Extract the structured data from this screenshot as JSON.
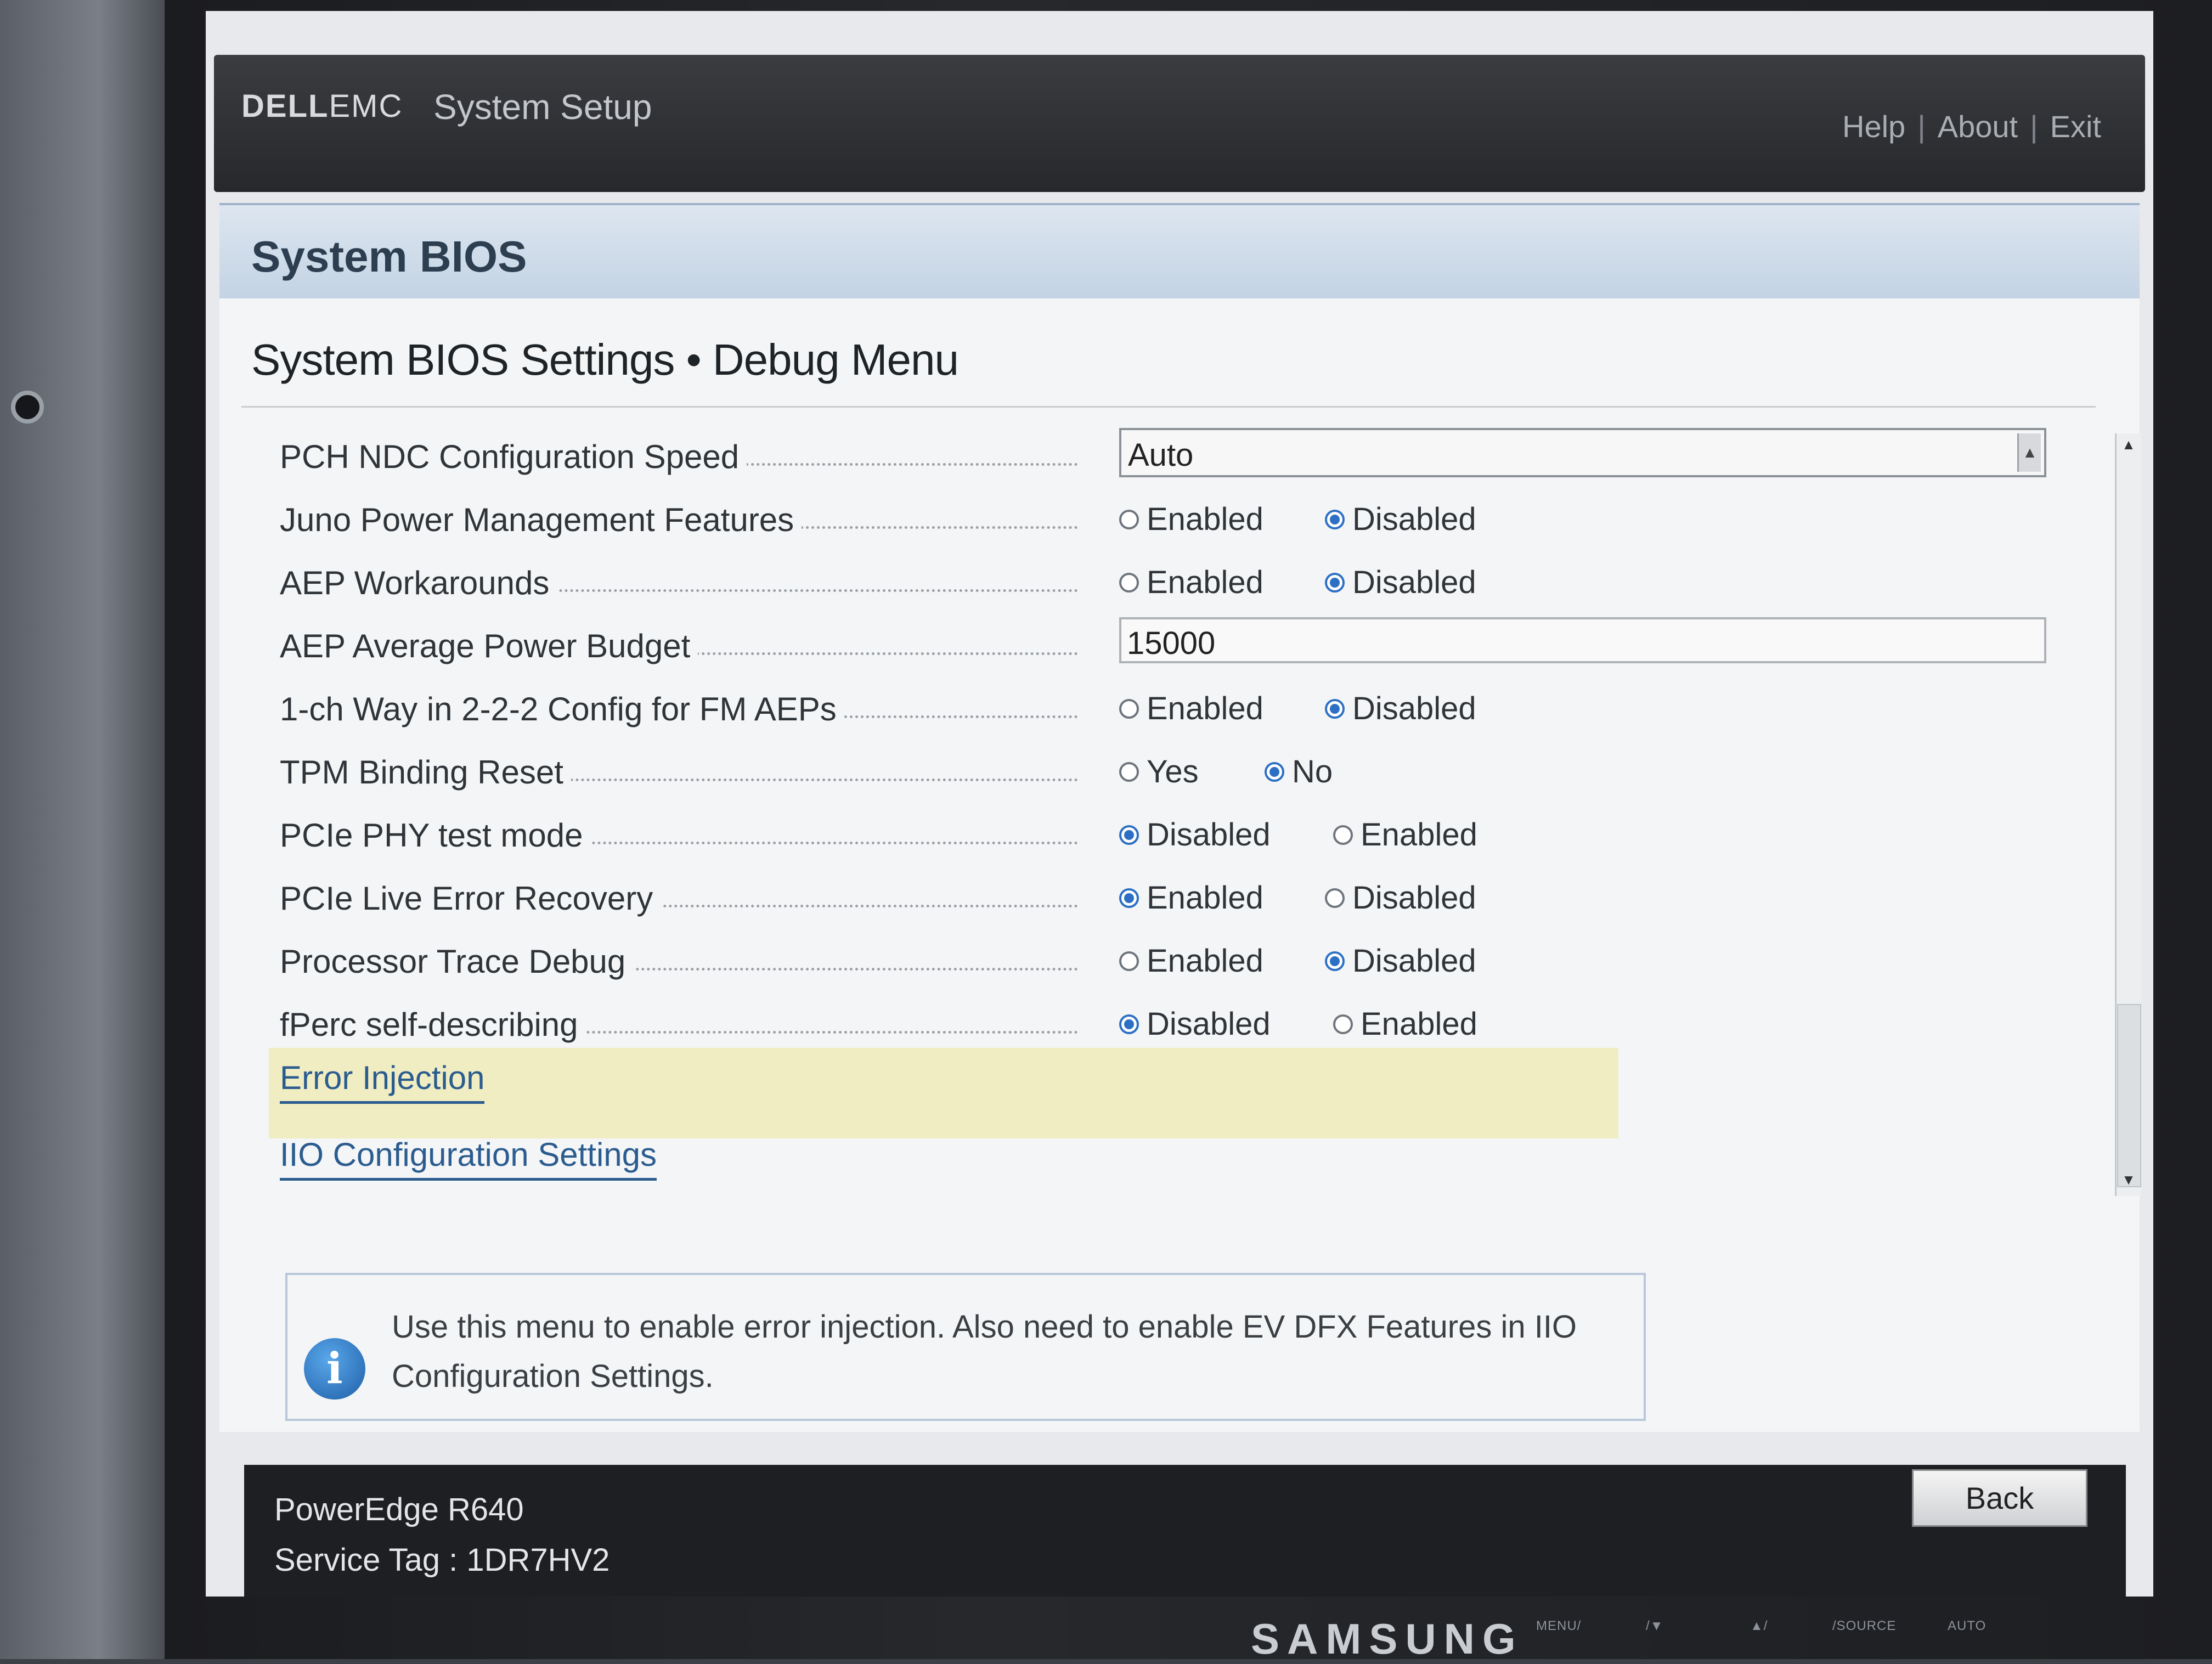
{
  "header": {
    "logo_bold": "DELL",
    "logo_light": "EMC",
    "app_title": "System Setup",
    "links": [
      "Help",
      "About",
      "Exit"
    ]
  },
  "section": {
    "title": "System BIOS"
  },
  "page": {
    "heading": "System BIOS Settings • Debug Menu"
  },
  "settings": {
    "pch_ndc": {
      "label": "PCH NDC Configuration Speed",
      "value": "Auto"
    },
    "juno": {
      "label": "Juno Power Management Features",
      "opt1": "Enabled",
      "opt2": "Disabled",
      "selected": "Disabled"
    },
    "aep_work": {
      "label": "AEP Workarounds",
      "opt1": "Enabled",
      "opt2": "Disabled",
      "selected": "Disabled"
    },
    "aep_budget": {
      "label": "AEP Average Power Budget",
      "value": "15000"
    },
    "one_ch": {
      "label": "1-ch Way in 2-2-2 Config for FM AEPs",
      "opt1": "Enabled",
      "opt2": "Disabled",
      "selected": "Disabled"
    },
    "tpm": {
      "label": "TPM Binding Reset",
      "opt1": "Yes",
      "opt2": "No",
      "selected": "No"
    },
    "pcie_phy": {
      "label": "PCIe PHY test mode",
      "opt1": "Disabled",
      "opt2": "Enabled",
      "selected": "Disabled"
    },
    "pcie_live": {
      "label": "PCIe Live Error Recovery",
      "opt1": "Enabled",
      "opt2": "Disabled",
      "selected": "Enabled"
    },
    "proc_trace": {
      "label": "Processor Trace Debug",
      "opt1": "Enabled",
      "opt2": "Disabled",
      "selected": "Disabled"
    },
    "fperc": {
      "label": "fPerc self-describing",
      "opt1": "Disabled",
      "opt2": "Enabled",
      "selected": "Disabled"
    }
  },
  "links": {
    "error_injection": "Error Injection",
    "iio_config": "IIO Configuration Settings"
  },
  "info": {
    "icon": "info-icon",
    "text": "Use this menu to enable error injection.  Also need to enable EV DFX Features in IIO Configuration Settings."
  },
  "footer": {
    "model": "PowerEdge R640",
    "service_tag": "Service Tag : 1DR7HV2",
    "back_label": "Back"
  },
  "monitor": {
    "brand": "SAMSUNG",
    "buttons": [
      "MENU/",
      "/▼",
      "▲/",
      "/SOURCE",
      "AUTO"
    ]
  },
  "colors": {
    "accent": "#2c6fc4",
    "link": "#2b5c8f",
    "highlight": "#f1edc2",
    "header_bar": "#26282b"
  }
}
